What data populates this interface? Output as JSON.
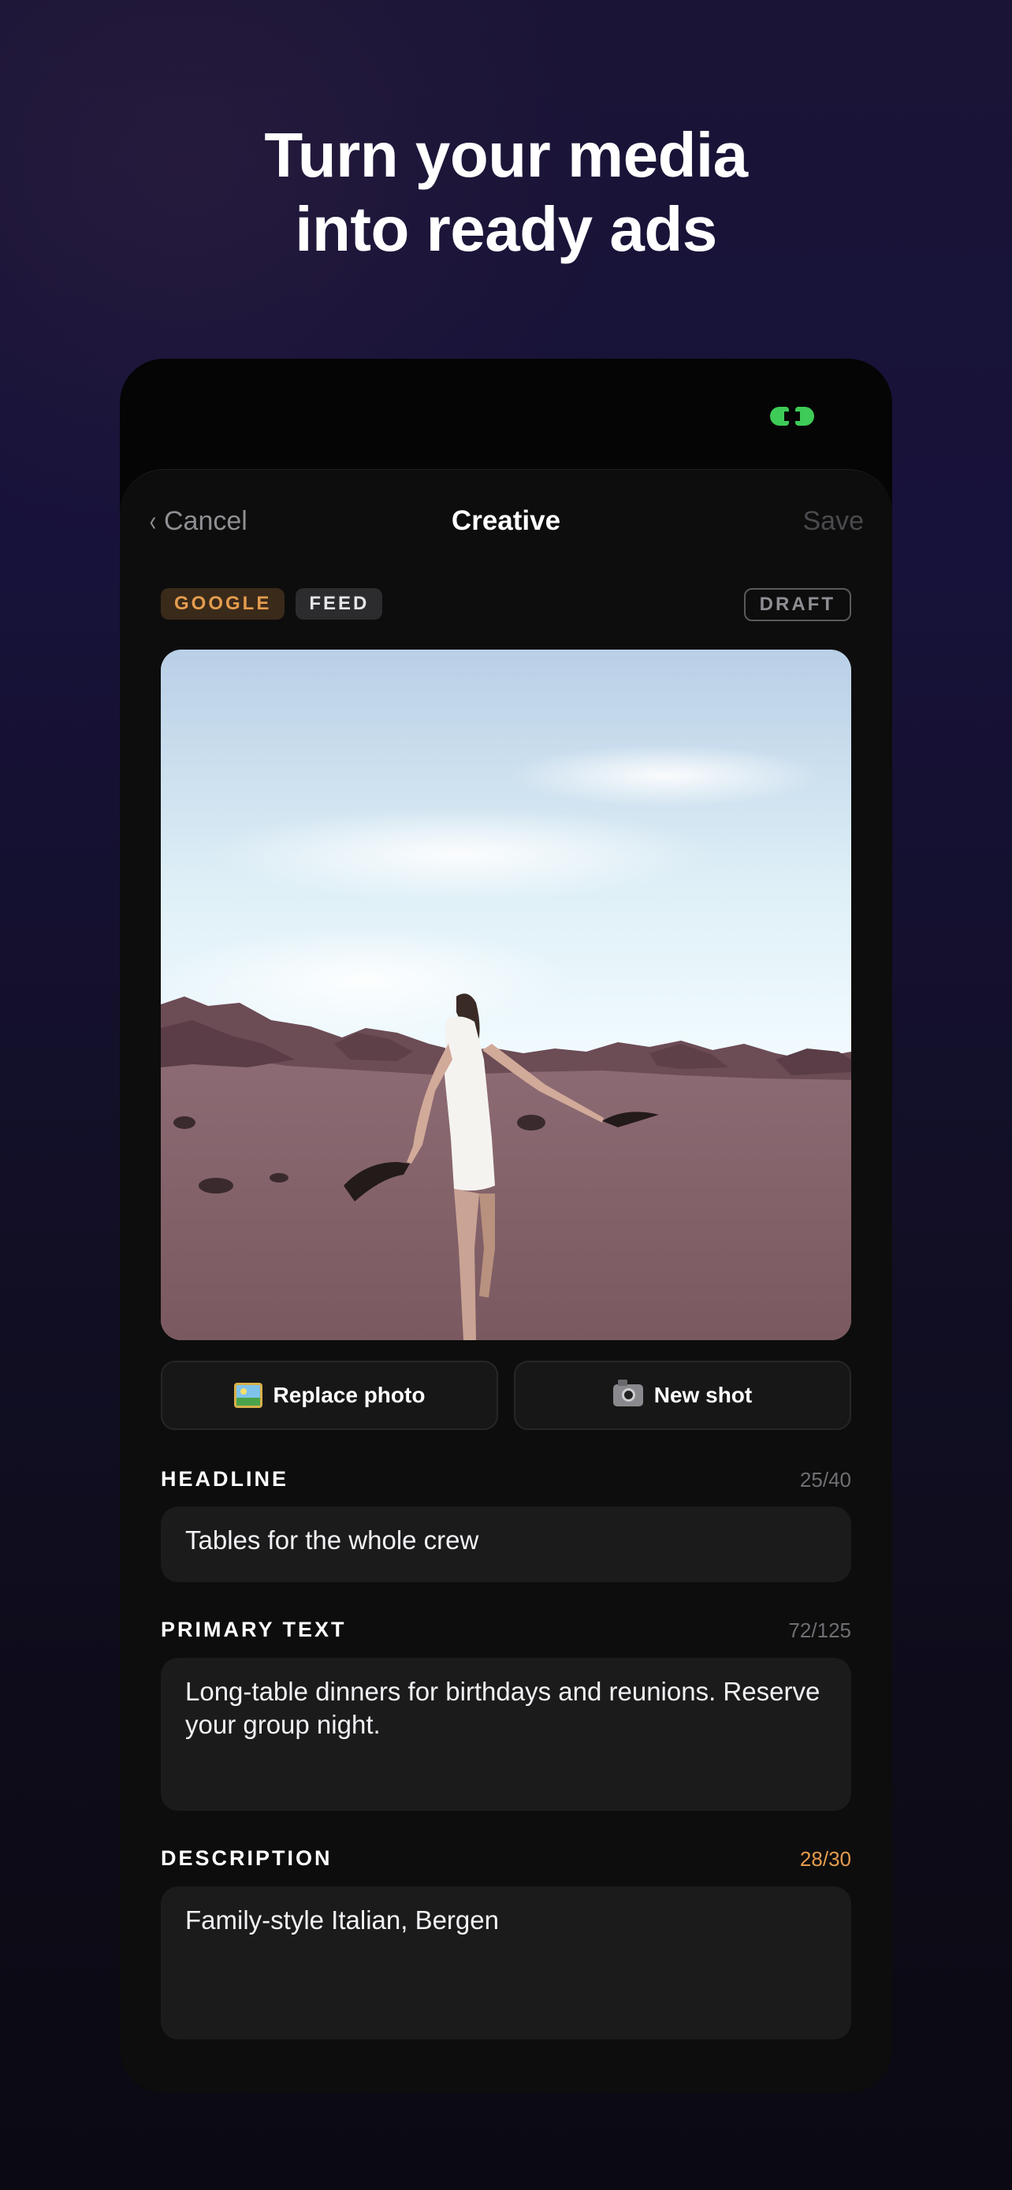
{
  "promo": {
    "line1": "Turn your media",
    "line2": "into ready ads"
  },
  "nav": {
    "cancel": "Cancel",
    "title": "Creative",
    "save": "Save"
  },
  "tags": {
    "google": "GOOGLE",
    "feed": "FEED",
    "status": "DRAFT"
  },
  "actions": {
    "replace": "Replace photo",
    "new_shot": "New shot"
  },
  "fields": {
    "headline": {
      "label": "HEADLINE",
      "count": "25/40",
      "value": "Tables for the whole crew"
    },
    "primary_text": {
      "label": "PRIMARY TEXT",
      "count": "72/125",
      "value": "Long-table dinners for birthdays and reunions. Reserve your group night."
    },
    "description": {
      "label": "DESCRIPTION",
      "count": "28/30",
      "value": "Family-style Italian, Bergen"
    }
  },
  "colors": {
    "accent_orange": "#e49c4e",
    "status_green": "#3ecb57"
  }
}
